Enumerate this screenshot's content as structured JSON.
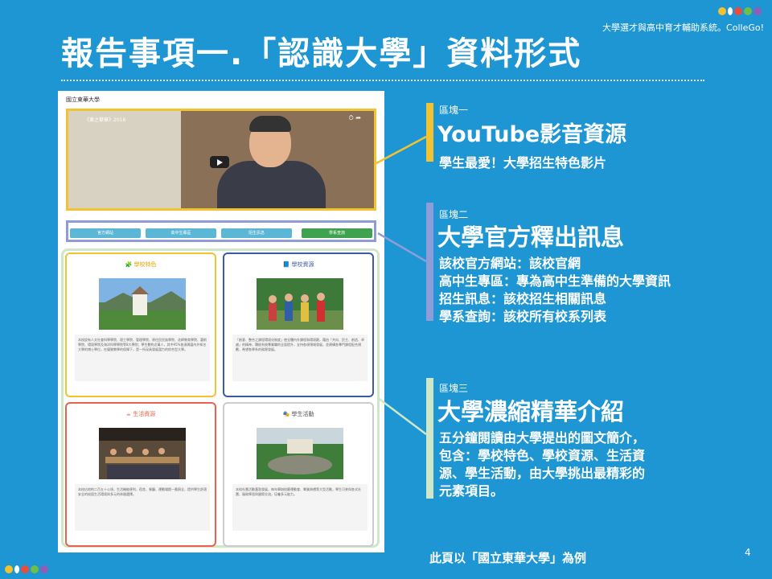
{
  "header": {
    "subtitle": "大學選才與高中育才輔助系統。ColleGo!",
    "title": "報告事項一.「認識大學」資料形式",
    "colors": [
      "#f2c12e",
      "#29a3d9",
      "#e84c3d",
      "#6cbf4b",
      "#8e5fb5"
    ]
  },
  "screenshot": {
    "school_name": "國立東華大學",
    "video_title": "《東之華章》2016",
    "tabs": [
      "官方網站",
      "高中生專區",
      "招生訊息",
      "學系查詢"
    ],
    "cards": [
      {
        "title": "學校特色",
        "color": "#f1c232",
        "icon": "puzzle-icon",
        "text": "本校設有人文社會科學學院、理工學院、管理學院、原住民民族學院、花師教育學院、藝術學院、環境學院及海洋科學學院等8大學院；學生數約近萬人，其中95%皆須周圍內外知名大學的博士學位，在優質教學的保障下，是一所深具發展潛力的綜合型大學。"
      },
      {
        "title": "學校資源",
        "color": "#3d5aa8",
        "icon": "book-icon",
        "text": "「創意、整合之課程環境化制度」使全體內外課程和環境觀，藉由「共向、民主、創造、卓越」的精神，積極系統專業職的全面提升，支持各項領域發展，並建構各專門課程配合規劃，希望各學系的務實發展。"
      },
      {
        "title": "生活資源",
        "color": "#e8624f",
        "icon": "cup-icon",
        "text": "本校佔地約二百五十公頃，生活機能便利，宿舍、餐廳、運動場館一應俱全，提供學生舒適安全的校園生活環境與多元的休閒選擇。"
      },
      {
        "title": "學生活動",
        "color": "#555555",
        "icon": "mask-icon",
        "text": "本校社團活動蓬勃發展，每年舉辦校慶運動會、畢業典禮等大型活動，學生可參與各式社團、服務學習與國際交流，培養多元能力。"
      }
    ]
  },
  "blocks": [
    {
      "label": "區塊一",
      "heading": "YouTube影音資源",
      "lines": [
        "學生最愛！大學招生特色影片"
      ],
      "color": "#f1c232"
    },
    {
      "label": "區塊二",
      "heading": "大學官方釋出訊息",
      "lines": [
        "該校官方網站：該校官網",
        "高中生專區：專為高中生準備的大學資訊",
        "招生訊息：該校招生相關訊息",
        "學系查詢：該校所有校系列表"
      ],
      "color": "#8e9dd9"
    },
    {
      "label": "區塊三",
      "heading": "大學濃縮精華介紹",
      "lines": [
        "五分鐘閱讀由大學提出的圖文簡介，",
        "包含：學校特色、學校資源、生活資",
        "源、學生活動，由大學挑出最精彩的",
        "元素項目。"
      ],
      "color": "#cfe7c9"
    }
  ],
  "footer": {
    "note": "此頁以「國立東華大學」為例",
    "page_number": "4"
  }
}
